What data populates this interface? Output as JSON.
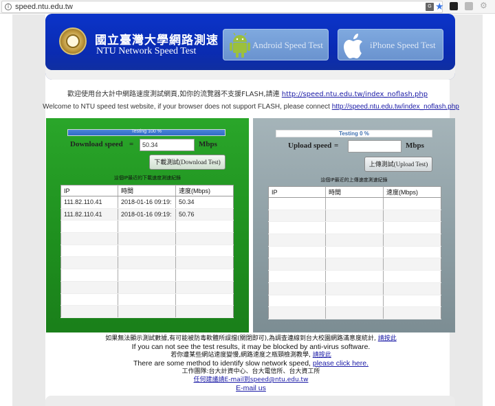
{
  "browser": {
    "url": "speed.ntu.edu.tw"
  },
  "banner": {
    "title_zh": "國立臺灣大學網路測速",
    "title_en": "NTU Network Speed Test",
    "android_label": "Android Speed Test",
    "iphone_label": "iPhone Speed Test"
  },
  "info": {
    "zh_text": "歡迎使用台大計中網路速度測試網頁,如你的流覽器不支援FLASH,請連 ",
    "zh_link": "http://speed.ntu.edu.tw/index_noflash.php",
    "en_text": "Welcome to NTU speed test website, if your browser does not support FLASH, please connect ",
    "en_link": "http://speed.ntu.edu.tw/index_noflash.php"
  },
  "download": {
    "progress_text": "Testing 100 %",
    "progress_fraction": 1.0,
    "label": "Download speed",
    "eq": "=",
    "value": "50.34",
    "unit": "Mbps",
    "button": "下載測試(Download Test)",
    "caption": "這個IP最近的下載速度測速紀錄",
    "headers": [
      "IP",
      "時間",
      "速度(Mbps)"
    ],
    "rows": [
      [
        "111.82.110.41",
        "2018-01-16 09:19:",
        "50.34"
      ],
      [
        "111.82.110.41",
        "2018-01-16 09:19:",
        "50.76"
      ]
    ]
  },
  "upload": {
    "progress_text": "Testing 0 %",
    "progress_fraction": 0.0,
    "label": "Upload speed",
    "eq": "=",
    "value": "",
    "unit": "Mbps",
    "button": "上傳測試(Upload Test)",
    "caption": "這個IP最近的上傳速度測速紀錄",
    "headers": [
      "IP",
      "時間",
      "速度(Mbps)"
    ],
    "rows": []
  },
  "footer": {
    "line1_text": "如果無法顯示測試數據,有可能被防毒軟體所誤擋(關閉即可),為調查連線到台大校園網路滿意度統計, ",
    "line1_link": "請按此",
    "line2": "If you can not see the test results, it may be blocked by anti-virus software.",
    "line3_text": "若你遭某些網站速度變慢,網路速度之瓶頸檢測教學, ",
    "line3_link": "請按此",
    "line4_text": "There are some method to identify slow network speed, ",
    "line4_link": "please click here.",
    "line5": "工作團隊:台大計資中心、台大電信所、台大資工所",
    "line6_link": "任何建議請E-mail到speed@ntu.edu.tw",
    "line7_link": "E-mail us"
  }
}
